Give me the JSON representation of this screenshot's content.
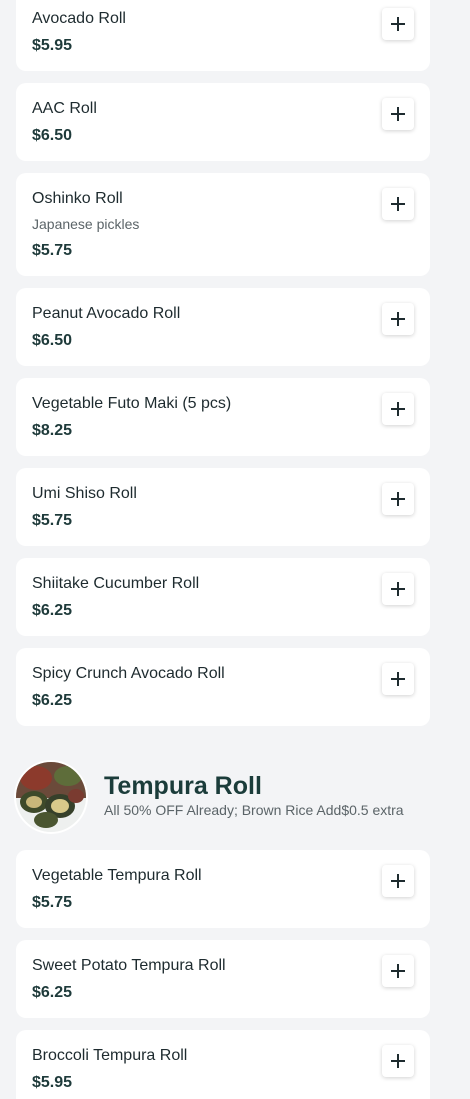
{
  "items_a": [
    {
      "name": "Avocado Roll",
      "price": "$5.95"
    },
    {
      "name": "AAC Roll",
      "price": "$6.50"
    },
    {
      "name": "Oshinko Roll",
      "description": "Japanese pickles",
      "price": "$5.75"
    },
    {
      "name": "Peanut Avocado Roll",
      "price": "$6.50"
    },
    {
      "name": "Vegetable Futo Maki (5 pcs)",
      "price": "$8.25"
    },
    {
      "name": "Umi Shiso Roll",
      "price": "$5.75"
    },
    {
      "name": "Shiitake Cucumber Roll",
      "price": "$6.25"
    },
    {
      "name": "Spicy Crunch Avocado Roll",
      "price": "$6.25"
    }
  ],
  "section": {
    "title": "Tempura Roll",
    "subtitle": "All 50% OFF Already; Brown Rice Add$0.5 extra",
    "image_icon": "tempura-roll-photo"
  },
  "items_b": [
    {
      "name": "Vegetable Tempura Roll",
      "price": "$5.75"
    },
    {
      "name": "Sweet Potato Tempura Roll",
      "price": "$6.25"
    },
    {
      "name": "Broccoli Tempura Roll",
      "price": "$5.95"
    }
  ],
  "icons": {
    "add": "plus-icon"
  },
  "colors": {
    "background": "#f3f4f6",
    "card": "#ffffff",
    "title": "#1b3c3a",
    "price": "#1e3a3a"
  }
}
